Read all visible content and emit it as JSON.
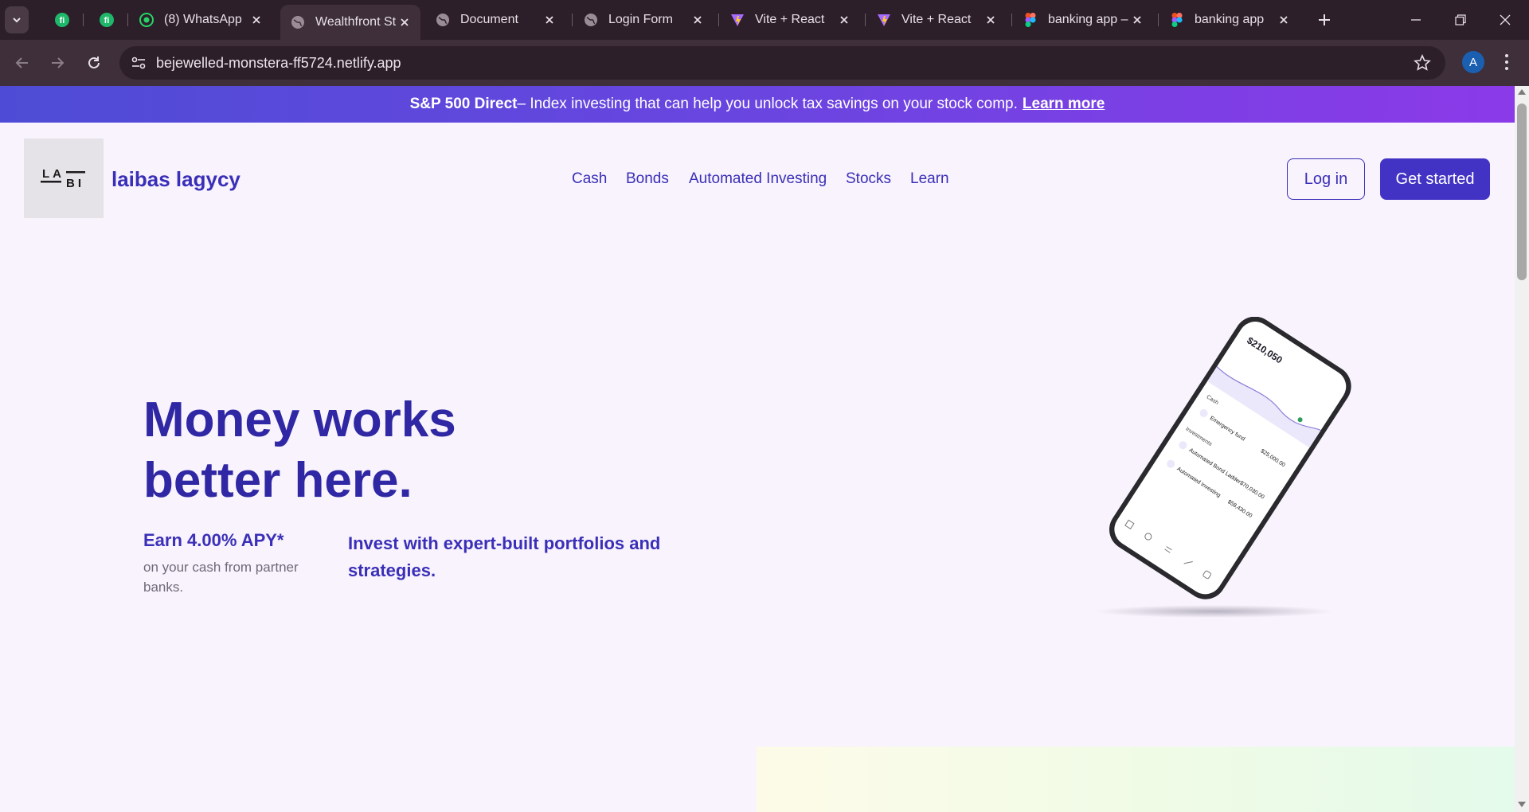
{
  "browser": {
    "tabs": [
      {
        "title": "",
        "icon": "fi-icon"
      },
      {
        "title": "",
        "icon": "fi-icon"
      },
      {
        "title": "(8) WhatsApp",
        "icon": "whatsapp-icon"
      },
      {
        "title": "Wealthfront St",
        "icon": "globe-icon",
        "active": true
      },
      {
        "title": "Document",
        "icon": "globe-icon"
      },
      {
        "title": "Login Form",
        "icon": "globe-icon"
      },
      {
        "title": "Vite + React",
        "icon": "vite-icon"
      },
      {
        "title": "Vite + React",
        "icon": "vite-icon"
      },
      {
        "title": "banking app –",
        "icon": "figma-icon"
      },
      {
        "title": "banking app",
        "icon": "figma-icon"
      }
    ],
    "url": "bejewelled-monstera-ff5724.netlify.app",
    "avatar_letter": "A"
  },
  "banner": {
    "bold": "S&P 500 Direct",
    "text": " – Index investing that can help you unlock tax savings on your stock comp.",
    "link": "Learn more"
  },
  "header": {
    "logo_text": "LA BI",
    "brand": "laibas lagycy",
    "nav": [
      "Cash",
      "Bonds",
      "Automated Investing",
      "Stocks",
      "Learn"
    ],
    "login": "Log in",
    "cta": "Get started"
  },
  "hero": {
    "title_line1": "Money works",
    "title_line2": "better here.",
    "apy_title": "Earn 4.00% APY*",
    "apy_sub": "on your cash from partner banks.",
    "invest_text": "Invest with expert-built portfolios and strategies."
  },
  "phone": {
    "balance": "$210,050",
    "sections": [
      "Cash",
      "Investments"
    ],
    "items": [
      {
        "name": "Emergency fund",
        "value": "$25,000.00"
      },
      {
        "name": "Automated Bond Ladder",
        "value": "$70,030.00"
      },
      {
        "name": "Automated Investing",
        "value": "$58,430.00"
      }
    ]
  }
}
